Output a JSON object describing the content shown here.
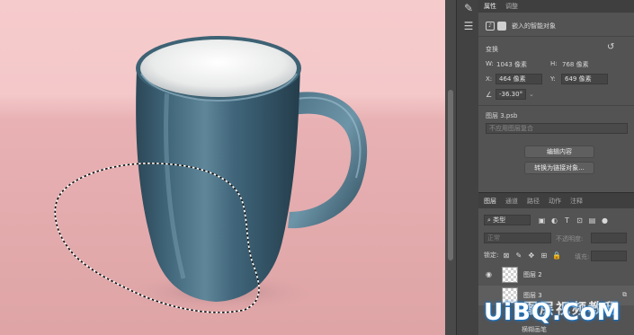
{
  "properties": {
    "tabs": [
      "属性",
      "调整"
    ],
    "type_label": "嵌入的智能对象",
    "transform_title": "变换",
    "w_label": "W:",
    "w_value": "1043 像素",
    "h_label": "H:",
    "h_value": "768 像素",
    "x_label": "X:",
    "x_value": "464 像素",
    "y_label": "Y:",
    "y_value": "649 像素",
    "angle_value": "-36.30°",
    "file_name": "图层 3.psb",
    "comp_placeholder": "不应用图层复合",
    "edit_contents_label": "编辑内容",
    "convert_linked_label": "转换为链接对象..."
  },
  "layers": {
    "tabs": [
      "图层",
      "通道",
      "路径",
      "动作",
      "注释"
    ],
    "filter_kind": "类型",
    "blend_mode": "正常",
    "opacity_label": "不透明度:",
    "lock_label": "锁定:",
    "fill_label": "填充:",
    "items": [
      {
        "name": "图层 2"
      },
      {
        "name": "图层 3"
      }
    ],
    "sub_label": "横糊画笔"
  },
  "watermark": {
    "main": "UiBQ.CoM",
    "chinese": "图层视频教程"
  }
}
